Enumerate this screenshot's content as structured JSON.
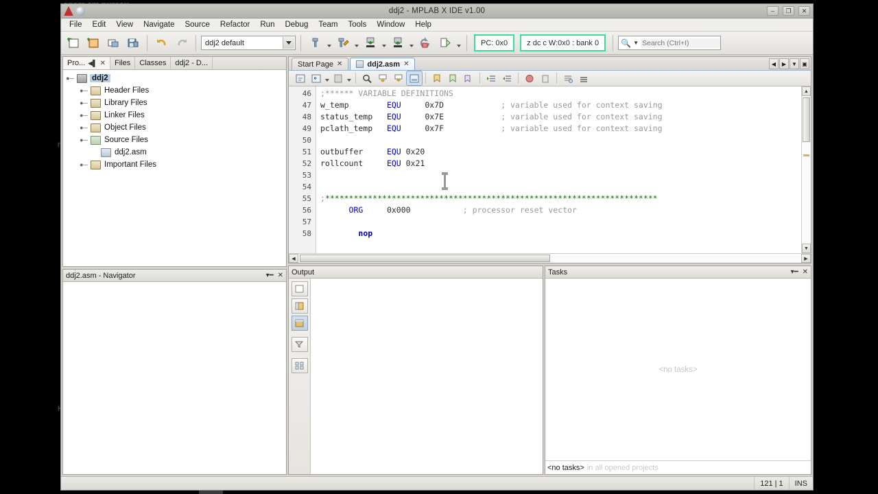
{
  "desktop": {
    "text_top_left": "onam am nureau",
    "text_left_1": "n",
    "text_left_2": "H"
  },
  "window": {
    "title": "ddj2 - MPLAB X IDE v1.00",
    "icons": {
      "app": "mplab-icon",
      "globe": "globe-icon"
    },
    "controls": {
      "minimize": "–",
      "maximize": "❐",
      "close": "✕"
    }
  },
  "menubar": {
    "items": [
      "File",
      "Edit",
      "View",
      "Navigate",
      "Source",
      "Refactor",
      "Run",
      "Debug",
      "Team",
      "Tools",
      "Window",
      "Help"
    ]
  },
  "toolbar": {
    "buttons": [
      {
        "name": "new-project-icon",
        "tooltip": "New Project"
      },
      {
        "name": "new-file-icon",
        "tooltip": "New File"
      },
      {
        "name": "open-project-icon",
        "tooltip": "Open Project"
      },
      {
        "name": "save-all-icon",
        "tooltip": "Save All"
      },
      {
        "name": "undo-icon",
        "tooltip": "Undo"
      },
      {
        "name": "redo-icon",
        "tooltip": "Redo"
      }
    ],
    "config_select": {
      "value": "ddj2  default",
      "name": "configuration-select"
    },
    "debug_buttons": [
      {
        "name": "build-project-icon",
        "tooltip": "Build Project"
      },
      {
        "name": "clean-build-icon",
        "tooltip": "Clean and Build Project"
      },
      {
        "name": "make-program-icon",
        "tooltip": "Make and Program Device"
      },
      {
        "name": "program-device-icon",
        "tooltip": "Program Device"
      },
      {
        "name": "hold-reset-icon",
        "tooltip": "Hold in Reset"
      },
      {
        "name": "debug-project-icon",
        "tooltip": "Debug Project"
      }
    ],
    "pc_indicator": "PC: 0x0",
    "status_indicator": "z dc c    W:0x0 : bank 0",
    "search": {
      "placeholder": "Search (Ctrl+I)",
      "value": "",
      "icon": "search-icon"
    }
  },
  "left_panel": {
    "tabs": [
      {
        "label": "Pro...",
        "active": true,
        "name": "tab-projects"
      },
      {
        "label": "Files",
        "active": false,
        "name": "tab-files"
      },
      {
        "label": "Classes",
        "active": false,
        "name": "tab-classes"
      },
      {
        "label": "ddj2 - D...",
        "active": false,
        "name": "tab-ddj2-dashboard"
      }
    ],
    "tree": [
      {
        "label": "ddj2",
        "icon": "project-icon",
        "depth": 0,
        "expander": "⚫",
        "selected": true
      },
      {
        "label": "Header Files",
        "icon": "folder-icon",
        "depth": 1,
        "expander": "⚫",
        "selected": false
      },
      {
        "label": "Library Files",
        "icon": "folder-icon",
        "depth": 1,
        "expander": "⚫",
        "selected": false
      },
      {
        "label": "Linker Files",
        "icon": "folder-icon",
        "depth": 1,
        "expander": "⚫",
        "selected": false
      },
      {
        "label": "Object Files",
        "icon": "folder-icon",
        "depth": 1,
        "expander": "⚫",
        "selected": false
      },
      {
        "label": "Source Files",
        "icon": "folder-open-icon",
        "depth": 1,
        "expander": "⚫",
        "selected": false
      },
      {
        "label": "ddj2.asm",
        "icon": "asm-file-icon",
        "depth": 2,
        "expander": "",
        "selected": false
      },
      {
        "label": "Important Files",
        "icon": "folder-icon",
        "depth": 1,
        "expander": "⚫",
        "selected": false
      }
    ]
  },
  "navigator": {
    "title": "ddj2.asm - Navigator",
    "minimize_icon": "minimize-icon",
    "close_icon": "close-icon"
  },
  "editor": {
    "tabs": [
      {
        "label": "Start Page",
        "active": false,
        "name": "editor-tab-start-page",
        "close": "✕"
      },
      {
        "label": "ddj2.asm",
        "active": true,
        "name": "editor-tab-ddj2-asm",
        "close": "✕"
      }
    ],
    "nav_buttons": [
      "◀",
      "▶",
      "▼",
      "▣"
    ],
    "toolbar_icons": [
      "last-edit-icon",
      "shift-line-left-icon",
      "comment-icon",
      "find-selection-icon",
      "find-previous-icon",
      "find-next-icon",
      "toggle-highlight-icon",
      "previous-bookmark-icon",
      "next-bookmark-icon",
      "toggle-bookmark-icon",
      "shift-left-icon",
      "shift-right-icon",
      "toggle-breakpoint-icon",
      "delete-breakpoint-icon",
      "start-macro-icon",
      "stop-macro-icon"
    ],
    "code_lines": [
      {
        "num": 46,
        "segments": [
          {
            "t": ";****** VARIABLE DEFINITIONS",
            "c": "cmt"
          }
        ]
      },
      {
        "num": 47,
        "segments": [
          {
            "t": "w_temp        ",
            "c": ""
          },
          {
            "t": "EQU",
            "c": "kw"
          },
          {
            "t": "     0x7D            ",
            "c": ""
          },
          {
            "t": "; variable used for context saving",
            "c": "cmt"
          }
        ]
      },
      {
        "num": 48,
        "segments": [
          {
            "t": "status_temp   ",
            "c": ""
          },
          {
            "t": "EQU",
            "c": "kw"
          },
          {
            "t": "     0x7E            ",
            "c": ""
          },
          {
            "t": "; variable used for context saving",
            "c": "cmt"
          }
        ]
      },
      {
        "num": 49,
        "segments": [
          {
            "t": "pclath_temp   ",
            "c": ""
          },
          {
            "t": "EQU",
            "c": "kw"
          },
          {
            "t": "     0x7F            ",
            "c": ""
          },
          {
            "t": "; variable used for context saving",
            "c": "cmt"
          }
        ]
      },
      {
        "num": 50,
        "segments": [
          {
            "t": "",
            "c": ""
          }
        ]
      },
      {
        "num": 51,
        "segments": [
          {
            "t": "outbuffer     ",
            "c": ""
          },
          {
            "t": "EQU",
            "c": "kw"
          },
          {
            "t": " 0x20",
            "c": ""
          }
        ]
      },
      {
        "num": 52,
        "segments": [
          {
            "t": "rollcount     ",
            "c": ""
          },
          {
            "t": "EQU",
            "c": "kw"
          },
          {
            "t": " 0x21",
            "c": ""
          }
        ]
      },
      {
        "num": 53,
        "segments": [
          {
            "t": "",
            "c": ""
          }
        ]
      },
      {
        "num": 54,
        "segments": [
          {
            "t": "",
            "c": ""
          }
        ]
      },
      {
        "num": 55,
        "segments": [
          {
            "t": ";",
            "c": "cmt"
          },
          {
            "t": "**********************************************************************",
            "c": "dots"
          }
        ]
      },
      {
        "num": 56,
        "segments": [
          {
            "t": "      ",
            "c": ""
          },
          {
            "t": "ORG",
            "c": "kw"
          },
          {
            "t": "     0x000           ",
            "c": ""
          },
          {
            "t": "; processor reset vector",
            "c": "cmt"
          }
        ]
      },
      {
        "num": 57,
        "segments": [
          {
            "t": "",
            "c": ""
          }
        ]
      },
      {
        "num": 58,
        "segments": [
          {
            "t": "        ",
            "c": ""
          },
          {
            "t": "nop",
            "c": "kw"
          }
        ]
      }
    ]
  },
  "output_panel": {
    "title": "Output",
    "sidebar_buttons": [
      "clear-output-icon",
      "window-output-1-icon",
      "window-output-2-icon",
      "filter-icon",
      "wrap-text-icon"
    ]
  },
  "tasks_panel": {
    "title": "Tasks",
    "minimize_icon": "minimize-icon",
    "close_icon": "close-icon",
    "empty_message": "<no tasks>",
    "footer_label": "<no tasks>",
    "footer_dim": "in all opened projects"
  },
  "statusbar": {
    "position": "121 | 1",
    "insert_mode": "INS"
  }
}
